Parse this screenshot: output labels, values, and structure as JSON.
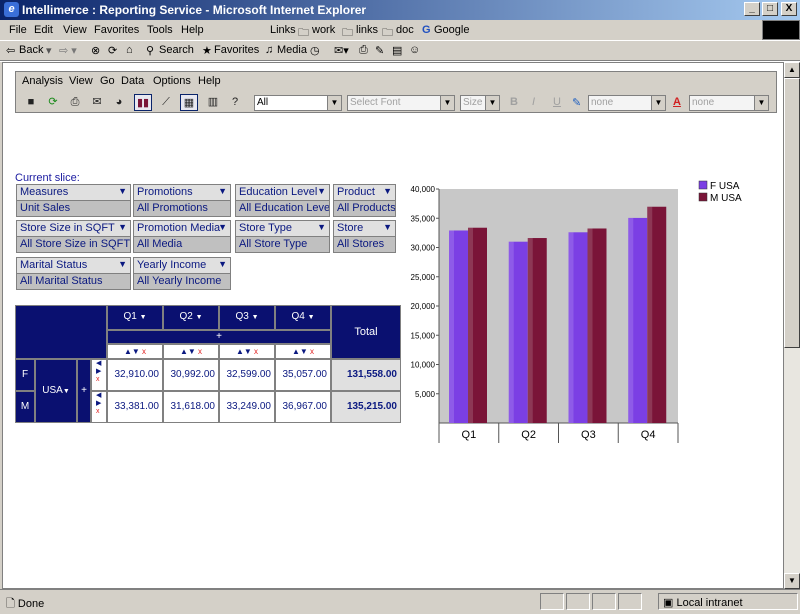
{
  "window": {
    "title": "Intellimerce : Reporting Service - Microsoft Internet Explorer",
    "min": "_",
    "max": "□",
    "close": "X"
  },
  "menubar": [
    "File",
    "Edit",
    "View",
    "Favorites",
    "Tools",
    "Help"
  ],
  "links": {
    "label": "Links",
    "items": [
      "work",
      "links",
      "doc",
      "Google"
    ]
  },
  "toolbar": {
    "back": "Back",
    "search": "Search",
    "favorites": "Favorites",
    "media": "Media"
  },
  "status": {
    "left": "Done",
    "zone": "Local intranet"
  },
  "app": {
    "menus": [
      "Analysis",
      "View",
      "Go",
      "Data",
      "Options",
      "Help"
    ],
    "selects": {
      "scope": "All",
      "font": "Select Font",
      "size": "Size",
      "highlight": "none",
      "color": "none"
    },
    "format": {
      "bold": "B",
      "italic": "I",
      "underline": "U",
      "fontcolor": "A"
    }
  },
  "slice": {
    "title": "Current slice:",
    "slicers": [
      {
        "name": "Measures",
        "value": "Unit Sales"
      },
      {
        "name": "Promotions",
        "value": "All Promotions"
      },
      {
        "name": "Education Level",
        "value": "All Education Level"
      },
      {
        "name": "Product",
        "value": "All Products"
      },
      {
        "name": "Store Size in SQFT",
        "value": "All Store Size in SQFT"
      },
      {
        "name": "Promotion Media",
        "value": "All Media"
      },
      {
        "name": "Store Type",
        "value": "All Store Type"
      },
      {
        "name": "Store",
        "value": "All Stores"
      },
      {
        "name": "Marital Status",
        "value": "All Marital Status"
      },
      {
        "name": "Yearly Income",
        "value": "All Yearly Income"
      }
    ]
  },
  "pivot": {
    "columns": [
      "Q1",
      "Q2",
      "Q3",
      "Q4"
    ],
    "total_label": "Total",
    "plus": "+",
    "row_dim": "USA",
    "rows": [
      {
        "label": "F",
        "values": [
          "32,910.00",
          "30,992.00",
          "32,599.00",
          "35,057.00"
        ],
        "total": "131,558.00"
      },
      {
        "label": "M",
        "values": [
          "33,381.00",
          "31,618.00",
          "33,249.00",
          "36,967.00"
        ],
        "total": "135,215.00"
      }
    ]
  },
  "chart_data": {
    "type": "bar",
    "categories": [
      "Q1",
      "Q2",
      "Q3",
      "Q4"
    ],
    "series": [
      {
        "name": "F USA",
        "values": [
          32910,
          30992,
          32599,
          35057
        ],
        "color": "#7b3fe4"
      },
      {
        "name": "M USA",
        "values": [
          33381,
          31618,
          33249,
          36967
        ],
        "color": "#7a1438"
      }
    ],
    "ylim": [
      0,
      40000
    ],
    "yticks": [
      "5,000",
      "10,000",
      "15,000",
      "20,000",
      "25,000",
      "30,000",
      "35,000",
      "40,000"
    ],
    "legend": "top-right",
    "grid": false
  }
}
